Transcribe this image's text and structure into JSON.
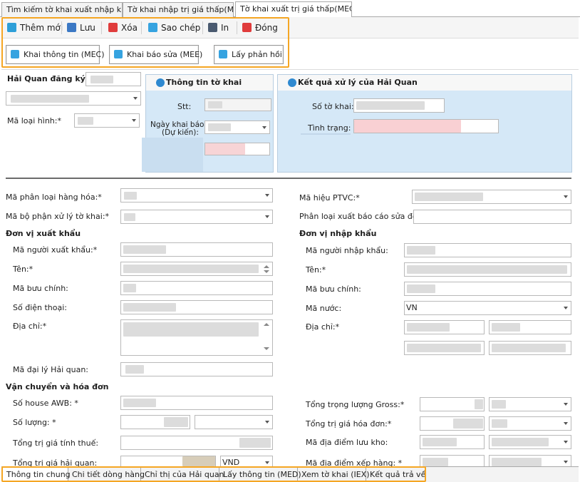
{
  "tabs": [
    {
      "label": "Tìm kiếm tờ khai xuất nhập khẩu"
    },
    {
      "label": "Tờ khai nhập trị giá thấp(MIC)"
    },
    {
      "label": "Tờ khai xuất trị giá thấp(MEC)"
    }
  ],
  "toolbar": {
    "add": "Thêm mới",
    "save": "Lưu",
    "delete": "Xóa",
    "copy": "Sao chép",
    "print": "In",
    "close": "Đóng"
  },
  "actions": {
    "declare": "Khai thông tin (MEC)",
    "amend": "Khai báo sửa (MEE)",
    "feedback": "Lấy phản hồi"
  },
  "header": {
    "customs_label": "Hải Quan đăng ký:",
    "type_label": "Mã loại hình:*"
  },
  "info_panel": {
    "title": "Thông tin tờ khai",
    "stt": "Stt:",
    "date_l1": "Ngày khai báo",
    "date_l2": "(Dự kiến):"
  },
  "result_panel": {
    "title": "Kết quả xử lý của Hải Quan",
    "number": "Số tờ khai:",
    "status": "Tình trạng:"
  },
  "general": {
    "goods_class": "Mã phân loại hàng hóa:*",
    "processing_unit": "Mã bộ phận xử lý tờ khai:*",
    "transport_code": "Mã hiệu PTVC:*",
    "amend_class": "Phân loại xuất báo cáo sửa đổi:"
  },
  "exporter": {
    "title": "Đơn vị xuất khẩu",
    "code": "Mã người xuất khẩu:*",
    "name": "Tên:*",
    "postal": "Mã bưu chính:",
    "phone": "Số điện thoại:",
    "address": "Địa chỉ:*",
    "agent": "Mã đại lý Hải quan:"
  },
  "importer": {
    "title": "Đơn vị nhập khẩu",
    "code": "Mã người nhập khẩu:",
    "name": "Tên:*",
    "postal": "Mã bưu chính:",
    "country": "Mã nước:",
    "country_value": "VN",
    "address": "Địa chỉ:*"
  },
  "transport": {
    "title": "Vận chuyển và hóa đơn",
    "awb": "Số house AWB: *",
    "qty": "Số lượng: *",
    "taxable": "Tổng trị giá tính thuế:",
    "customs_value": "Tổng trị giá hải quan:",
    "currency": "VND",
    "gross": "Tổng trọng lượng Gross:*",
    "invoice": "Tổng trị giá hóa đơn:*",
    "storage": "Mã địa điểm lưu kho:",
    "loading": "Mã địa điểm xếp hàng: *"
  },
  "bottom_tabs": [
    {
      "label": "Thông tin chung"
    },
    {
      "label": "Chi tiết dòng hàng"
    },
    {
      "label": "Chỉ thị của Hải quan"
    },
    {
      "label": "Lấy thông tin (MED)"
    },
    {
      "label": "Xem tờ khai (IEX)"
    },
    {
      "label": "Kết quả trả về"
    }
  ],
  "colors": {
    "highlight": "#f5a623",
    "panel_bg": "#d5e8f7",
    "status_bg": "#f9d0d3",
    "delete_icon": "#e03c3c",
    "add_icon": "#2e9fd8"
  }
}
